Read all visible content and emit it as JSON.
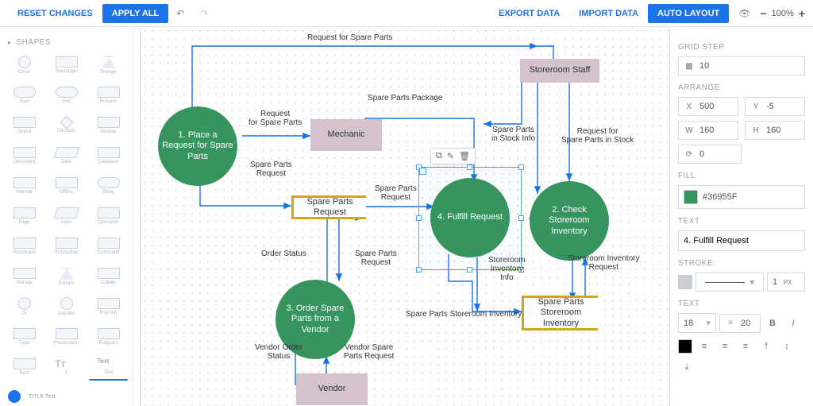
{
  "topbar": {
    "reset": "RESET CHANGES",
    "apply": "APPLY ALL",
    "export": "EXPORT DATA",
    "import": "IMPORT DATA",
    "auto": "AUTO LAYOUT",
    "zoom": "100%"
  },
  "left": {
    "title": "SHAPES",
    "shapes": [
      {
        "name": "circle",
        "label": "Circle"
      },
      {
        "name": "rect",
        "label": "Rectangle"
      },
      {
        "name": "triangle",
        "label": "Triangle"
      },
      {
        "name": "start",
        "label": "Start"
      },
      {
        "name": "end",
        "label": "End"
      },
      {
        "name": "process",
        "label": "Process"
      },
      {
        "name": "output",
        "label": "Output"
      },
      {
        "name": "decision",
        "label": "Decision"
      },
      {
        "name": "display",
        "label": "Display"
      },
      {
        "name": "document",
        "label": "Document"
      },
      {
        "name": "data",
        "label": "Data"
      },
      {
        "name": "database",
        "label": "Database"
      },
      {
        "name": "internal",
        "label": "Internal"
      },
      {
        "name": "offline",
        "label": "Offline"
      },
      {
        "name": "delay",
        "label": "Delay"
      },
      {
        "name": "page",
        "label": "Page"
      },
      {
        "name": "input",
        "label": "Input"
      },
      {
        "name": "operation",
        "label": "Operation"
      },
      {
        "name": "punchcard",
        "label": "Punchcard"
      },
      {
        "name": "subroutine",
        "label": "Subroutine"
      },
      {
        "name": "command",
        "label": "Command"
      },
      {
        "name": "storage",
        "label": "Storage"
      },
      {
        "name": "extract",
        "label": "Extract"
      },
      {
        "name": "collate",
        "label": "Collate"
      },
      {
        "name": "or",
        "label": "Or"
      },
      {
        "name": "junction",
        "label": "Junction"
      },
      {
        "name": "framing",
        "label": "Framing"
      },
      {
        "name": "tape",
        "label": "Tape"
      },
      {
        "name": "preparation",
        "label": "Preparation"
      },
      {
        "name": "endpoint",
        "label": "Endpoint"
      },
      {
        "name": "rect2",
        "label": "Rect"
      },
      {
        "name": "tt",
        "label": "T"
      },
      {
        "name": "text",
        "label": "Text"
      }
    ],
    "title_text": "TITLE Text"
  },
  "nodes": {
    "n1": "1. Place a Request for Spare Parts",
    "n2": "Mechanic",
    "n3": "Spare Parts Request",
    "n4": "3. Order Spare Parts from a Vendor",
    "n5": "Vendor",
    "n6": "4. Fulfill Request",
    "n7": "2. Check Storeroom Inventory",
    "n8": "Storeroom Staff",
    "n9": "Spare Parts Storeroom Inventory"
  },
  "edges": {
    "e1": "Request for Spare Parts",
    "e2": "Request\nfor Spare Parts",
    "e3": "Spare Parts\nRequest",
    "e4": "Spare Parts\nRequest",
    "e5": "Order Status",
    "e6": "Spare Parts\nRequest",
    "e7": "Vendor Order\nStatus",
    "e8": "Vendor Spare\nParts Request",
    "e9": "Spare Parts Package",
    "e10": "Spare Parts\nin Stock Info",
    "e11": "Request for\nSpare Parts in Stock",
    "e12": "Storeroom\nInventory\nInfo",
    "e13": "Storeroom Inventory\nRequest",
    "e14": "Spare Parts Storeroom Inventory"
  },
  "right": {
    "grid_step": "GRID STEP",
    "grid_val": "10",
    "arrange": "ARRANGE",
    "x": "500",
    "y": "-5",
    "w": "160",
    "h": "160",
    "rot": "0",
    "fill": "FILL",
    "fill_val": "#36955F",
    "text": "TEXT",
    "text_val": "4. Fulfill Request",
    "stroke": "STROKE",
    "stroke_w": "1",
    "stroke_unit": "PX",
    "text2": "TEXT",
    "fs": "18",
    "lh": "20"
  }
}
